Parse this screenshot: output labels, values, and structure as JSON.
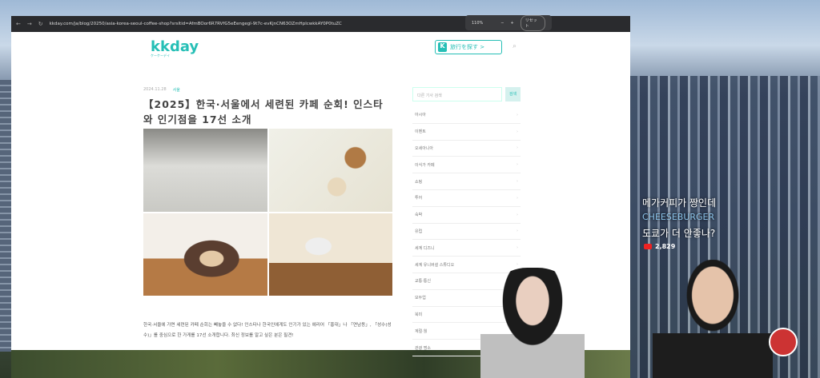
{
  "browser": {
    "url": "kkday.com/ja/blog/20250/asia-korea-seoul-coffee-shop?srsltid=AfmBOor6R7RVfG5eEengegl-9t7c-evKjnCN63OZmHplcwkkAY0P0tuZC",
    "zoom": {
      "level": "110%",
      "minus": "−",
      "plus": "+",
      "reset": "リセット"
    }
  },
  "site": {
    "logo": "kkday",
    "logo_sub": "ケーケーデイ",
    "find_button": "旅行を探す  >",
    "find_k": "K"
  },
  "article": {
    "date": "2024.11.28",
    "category": "서울",
    "title": "【2025】한국·서울에서 세련된 카페 순회! 인스타와 인기점을 17선 소개",
    "body": "한국·서울에 가면 세련된 카페 순회는 빼놓을 수 없다! 인스타나 한국인에게도 인기가 있는 에리어 「홍대」나 「연남동」, 「성수(성수)」를 중심으로 한 가게를 17선 소개합니다. 최신 정보를 알고 싶은 분은 필견!"
  },
  "sidebar": {
    "search_placeholder": "다른 기사 검색",
    "search_button": "검색",
    "items": [
      "아시아",
      "이벤트",
      "오세아니아",
      "이식가 카페",
      "쇼핑",
      "투어",
      "숙박",
      "유럽",
      "세계 디즈니",
      "세계 유니버설 스튜디오",
      "교통·통신",
      "모두업",
      "북미",
      "계절·월",
      "관광 명소"
    ]
  },
  "overlay": {
    "line1": "메가커피가 짱인데",
    "line2": "CHEESEBURGER",
    "line3": "도쿄가 더 안좋나?",
    "views": "2,829"
  }
}
